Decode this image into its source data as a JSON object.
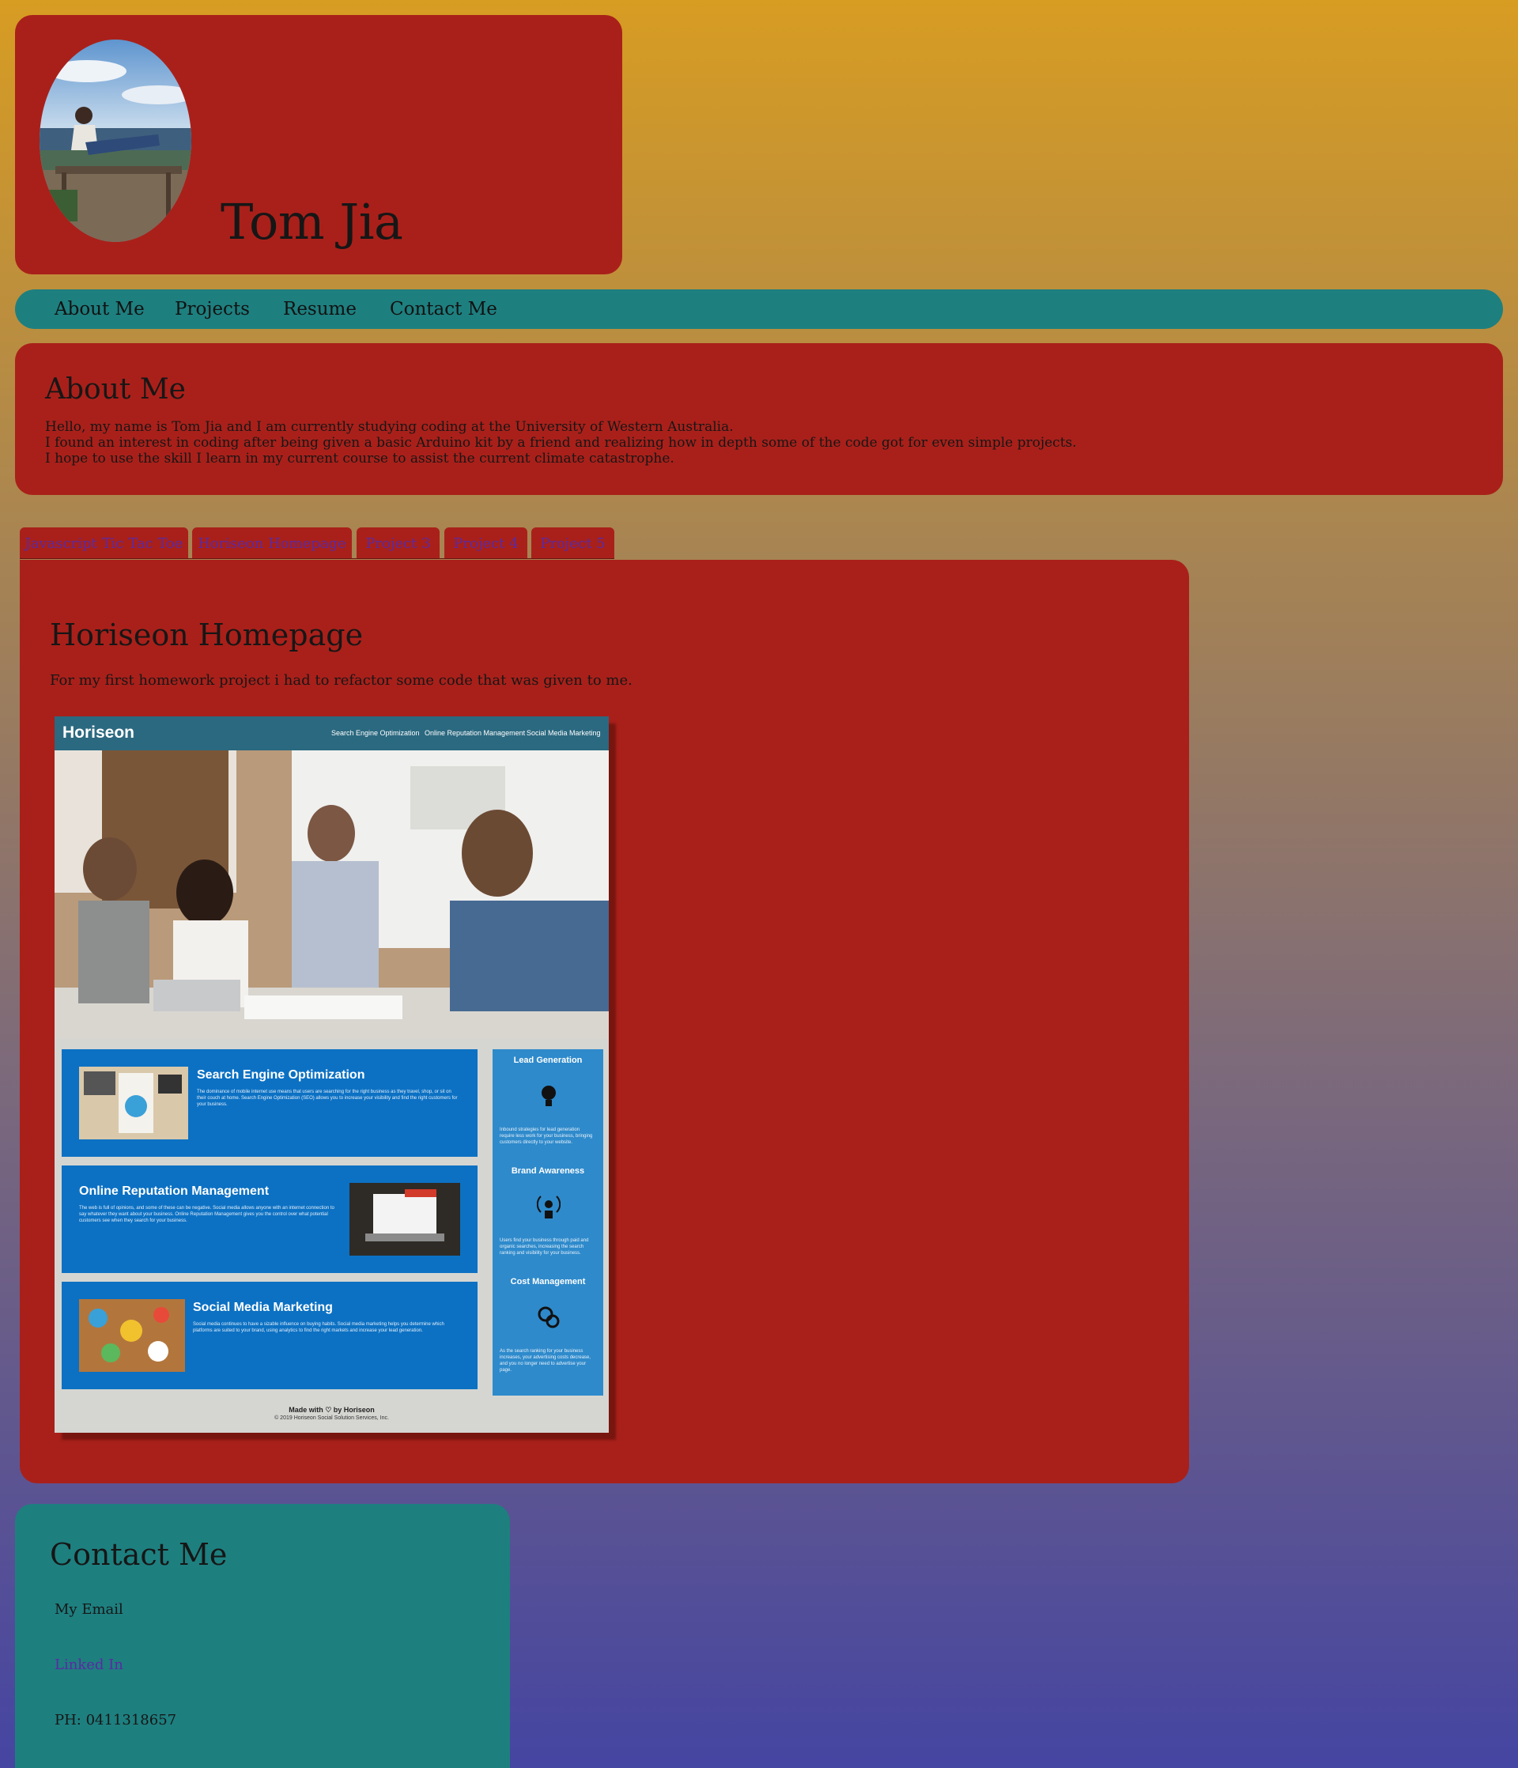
{
  "header": {
    "title": "Tom Jia"
  },
  "nav": {
    "items": [
      "About Me",
      "Projects",
      "Resume",
      "Contact Me"
    ]
  },
  "about": {
    "heading": "About Me",
    "lines": [
      "Hello, my name is Tom Jia and I am currently studying coding at the University of Western Australia.",
      "I found an interest in coding after being given a basic Arduino kit by a friend and realizing how in depth some of the code got for even simple projects.",
      "I hope to use the skill I learn in my current course to assist the current climate catastrophe."
    ]
  },
  "projects": {
    "tabs": [
      "Javascript Tic Tac Toe",
      "Horiseon Homepage",
      "Project 3",
      "Project 4",
      "Project 5"
    ],
    "active_tab": "Horiseon Homepage",
    "active": {
      "title": "Horiseon Homepage",
      "description": "For my first homework project i had to refactor some code that was given to me."
    }
  },
  "screenshot": {
    "logo": "Horiseon",
    "nav": [
      "Search Engine Optimization",
      "Online Reputation Management",
      "Social Media Marketing"
    ],
    "cards": [
      {
        "title": "Search Engine Optimization",
        "text": "The dominance of mobile internet use means that users are searching for the right business as they travel, shop, or sit on their couch at home. Search Engine Optimization (SEO) allows you to increase your visibility and find the right customers for your business."
      },
      {
        "title": "Online Reputation Management",
        "text": "The web is full of opinions, and some of these can be negative. Social media allows anyone with an internet connection to say whatever they want about your business. Online Reputation Management gives you the control over what potential customers see when they search for your business."
      },
      {
        "title": "Social Media Marketing",
        "text": "Social media continues to have a sizable influence on buying habits. Social media marketing helps you determine which platforms are suited to your brand, using analytics to find the right markets and increase your lead generation."
      }
    ],
    "side": [
      {
        "title": "Lead Generation",
        "text": "Inbound strategies for lead generation require less work for your business, bringing customers directly to your website."
      },
      {
        "title": "Brand Awareness",
        "text": "Users find your business through paid and organic searches, increasing the search ranking and visibility for your business."
      },
      {
        "title": "Cost Management",
        "text": "As the search ranking for your business increases, your advertising costs decrease, and you no longer need to advertise your page."
      }
    ],
    "footer_made": "Made with ♡ by Horiseon",
    "footer_copy": "© 2019 Horiseon Social Solution Services, Inc."
  },
  "contact": {
    "heading": "Contact Me",
    "email_label": "My Email",
    "linkedin_label": "Linked In",
    "phone": "PH: 0411318657"
  },
  "colors": {
    "panel_red": "#a9201a",
    "panel_teal": "#1e7f7f",
    "link_purple": "#5b2aa3",
    "card_blue": "#0c71c3"
  }
}
